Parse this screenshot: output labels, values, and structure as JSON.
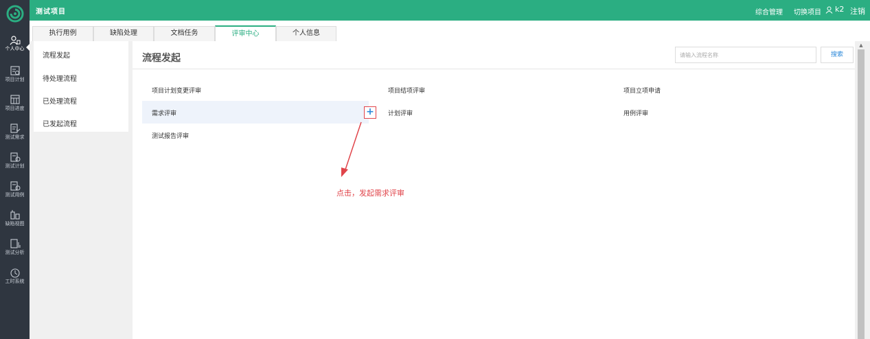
{
  "app": {
    "project_title": "测试项目"
  },
  "header": {
    "links": [
      {
        "label": "综合管理",
        "key": "overall"
      },
      {
        "label": "切换项目",
        "key": "switch"
      },
      {
        "label": "k2",
        "key": "user"
      },
      {
        "label": "注销",
        "key": "logout"
      }
    ]
  },
  "leftnav": {
    "items": [
      {
        "label": "个人中心",
        "icon": "user-center-icon",
        "active": true
      },
      {
        "label": "项目计划",
        "icon": "project-plan-icon"
      },
      {
        "label": "项目进度",
        "icon": "project-progress-icon"
      },
      {
        "label": "测试需求",
        "icon": "test-requirement-icon"
      },
      {
        "label": "测试计划",
        "icon": "test-plan-icon"
      },
      {
        "label": "测试用例",
        "icon": "test-case-icon"
      },
      {
        "label": "缺陷视图",
        "icon": "defect-view-icon"
      },
      {
        "label": "测试分析",
        "icon": "test-analysis-icon"
      },
      {
        "label": "工时系统",
        "icon": "timesheet-icon"
      }
    ]
  },
  "tabs": [
    {
      "label": "执行用例"
    },
    {
      "label": "缺陷处理"
    },
    {
      "label": "文档任务"
    },
    {
      "label": "评审中心",
      "active": true
    },
    {
      "label": "个人信息"
    }
  ],
  "subnav": {
    "items": [
      {
        "label": "流程发起"
      },
      {
        "label": "待处理流程"
      },
      {
        "label": "已处理流程"
      },
      {
        "label": "已发起流程"
      }
    ]
  },
  "main": {
    "title": "流程发起",
    "search": {
      "placeholder": "请输入流程名称",
      "value": "",
      "button_label": "搜索"
    },
    "processes": [
      {
        "label": "项目计划变更评审"
      },
      {
        "label": "项目结项评审"
      },
      {
        "label": "项目立项申请"
      },
      {
        "label": "需求评审"
      },
      {
        "label": "计划评审"
      },
      {
        "label": "用例评审"
      },
      {
        "label": "测试报告评审"
      }
    ],
    "add_button_label": "+",
    "annotation": "点击，发起需求评审"
  },
  "colors": {
    "header_green": "#2bae82",
    "sidebar_dark": "#2f3640",
    "link_blue": "#2b88d9",
    "annotation_red": "#e0444a"
  }
}
